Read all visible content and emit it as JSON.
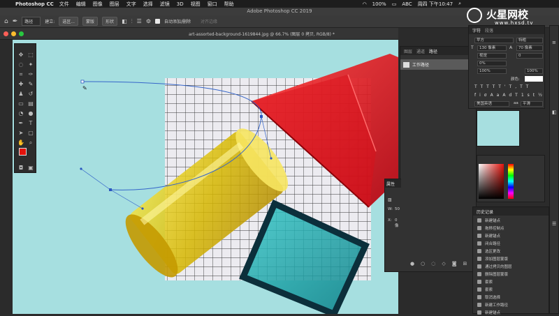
{
  "menubar": {
    "app_name": "Photoshop CC",
    "items": [
      "文件",
      "编辑",
      "图像",
      "图层",
      "文字",
      "选择",
      "滤镜",
      "3D",
      "视图",
      "窗口",
      "帮助"
    ],
    "battery": "100%",
    "input_method": "ABC",
    "clock": "周四 下午10:47"
  },
  "window": {
    "title": "Adobe Photoshop CC 2019"
  },
  "options_bar": {
    "mode_select": "路径",
    "make_label": "建立:",
    "selection_btn": "选区...",
    "mask_btn": "蒙版",
    "shape_btn": "形状",
    "auto_add_delete": "自动添加/删除",
    "align_edges": "对齐边缘"
  },
  "document": {
    "tab_title": "art-assorted-background-1619844.jpg @ 66.7% (图层 0 拷贝, RGB/8) *"
  },
  "paths_panel": {
    "tabs": [
      "图层",
      "通道",
      "路径"
    ],
    "active_tab": "路径",
    "path_name": "工作路径"
  },
  "properties_panel": {
    "tab": "属性",
    "w_label": "W:",
    "w_value": "50",
    "x_label": "X:",
    "x_value": "0 像"
  },
  "character_panel": {
    "tabs": [
      "字符",
      "段落"
    ],
    "font_family": "苹方",
    "font_style": "特粗",
    "font_size": "130 像素",
    "leading": "70 像素",
    "kerning": "视觉",
    "tracking": "0",
    "tsume": "0%",
    "vscale": "100%",
    "hscale": "100%",
    "color_label": "颜色:",
    "language": "美国英语",
    "aa_mode": "aa",
    "aa_value": "平滑"
  },
  "history_panel": {
    "tab": "历史记录",
    "items": [
      "新建锚点",
      "拖移控制点",
      "新建锚点",
      "闭合路径",
      "选区更改",
      "添加图层蒙版",
      "通过拷贝的图层",
      "删除图层蒙版",
      "套索",
      "套索",
      "取消选择",
      "新建工作路径",
      "新建锚点"
    ]
  },
  "watermark": {
    "brand": "火星网校",
    "url": "www.hxsd.tv"
  },
  "colors": {
    "foreground": "#e3120b",
    "background": "#000000"
  }
}
